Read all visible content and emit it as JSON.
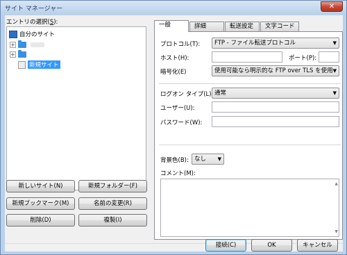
{
  "window": {
    "title": "サイト マネージャー",
    "close_glyph": "✕"
  },
  "left": {
    "entry_label_prefix": "エントリの選択(",
    "entry_label_key": "S",
    "entry_label_suffix": "):",
    "tree": {
      "root": "自分のサイト",
      "new_site": "新規サイト"
    },
    "buttons": {
      "new_site": "新しいサイト(N)",
      "new_folder": "新規フォルダー(F)",
      "new_bookmark": "新規ブックマーク(M)",
      "rename": "名前の変更(R)",
      "delete": "削除(D)",
      "duplicate": "複製(I)"
    }
  },
  "tabs": [
    "一般",
    "詳細",
    "転送設定",
    "文字コード"
  ],
  "general": {
    "protocol_label": "プロトコル(T):",
    "protocol_value": "FTP - ファイル転送プロトコル",
    "host_label": "ホスト(H):",
    "port_label": "ポート(P):",
    "encryption_label": "暗号化(E)",
    "encryption_value": "使用可能なら明示的な FTP over TLS を使用",
    "logon_label": "ログオン タイプ(L):",
    "logon_value": "通常",
    "user_label": "ユーザー(U):",
    "password_label": "パスワード(W):",
    "bgcolor_label": "背景色(B):",
    "bgcolor_value": "なし",
    "comment_label": "コメント(M):"
  },
  "footer": {
    "connect": "接続(C)",
    "ok": "OK",
    "cancel": "キャンセル"
  }
}
